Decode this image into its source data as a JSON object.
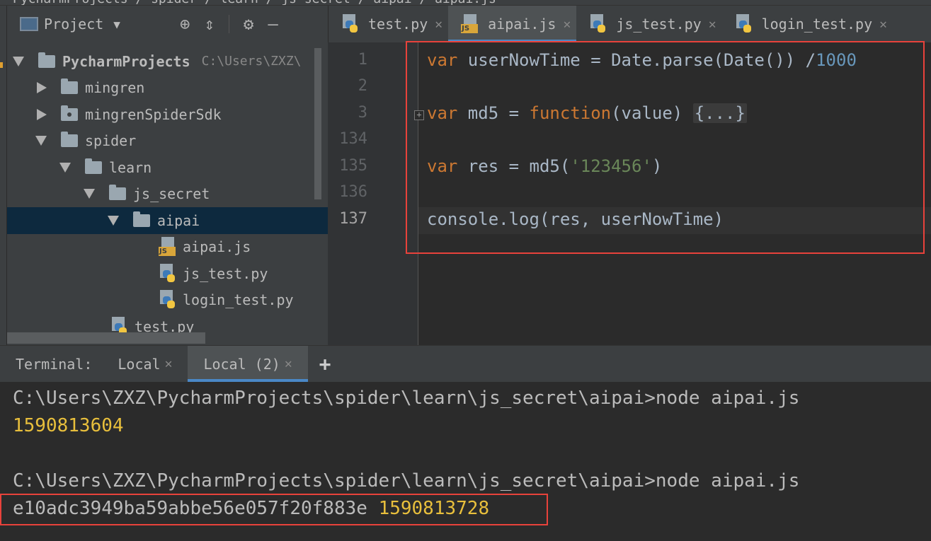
{
  "breadcrumb": {
    "items": [
      "PycharmProjects",
      "spider",
      "learn",
      "js_secret",
      "aipai",
      "aipai.js"
    ]
  },
  "project_panel": {
    "title": "Project",
    "tree": [
      {
        "label": "PycharmProjects",
        "hint": "C:\\Users\\ZXZ\\",
        "kind": "folder",
        "expanded": true
      },
      {
        "label": "mingren",
        "kind": "folder",
        "expanded": false
      },
      {
        "label": "mingrenSpiderSdk",
        "kind": "folder",
        "expanded": false
      },
      {
        "label": "spider",
        "kind": "folder",
        "expanded": true
      },
      {
        "label": "learn",
        "kind": "folder",
        "expanded": true
      },
      {
        "label": "js_secret",
        "kind": "folder",
        "expanded": true
      },
      {
        "label": "aipai",
        "kind": "folder",
        "expanded": true,
        "selected": true
      },
      {
        "label": "aipai.js",
        "kind": "js"
      },
      {
        "label": "js_test.py",
        "kind": "py"
      },
      {
        "label": "login_test.py",
        "kind": "py"
      },
      {
        "label": "test.py",
        "kind": "py"
      }
    ]
  },
  "editor_tabs": [
    {
      "label": "test.py",
      "icon": "python-file-icon"
    },
    {
      "label": "aipai.js",
      "icon": "js-file-icon",
      "active": true
    },
    {
      "label": "js_test.py",
      "icon": "python-file-icon"
    },
    {
      "label": "login_test.py",
      "icon": "python-file-icon"
    }
  ],
  "editor": {
    "line_numbers": [
      "1",
      "2",
      "3",
      "134",
      "135",
      "136",
      "137"
    ],
    "code": {
      "line1": {
        "kw": "var",
        "rest": " userNowTime = Date.parse(Date()) /",
        "num": "1000"
      },
      "line3": {
        "kw": "var",
        "mid": " md5 = ",
        "fn": "function",
        "params": "(value) ",
        "folded": "{...}"
      },
      "line135": {
        "kw": "var",
        "mid": " res = md5(",
        "str": "'123456'",
        "end": ")"
      },
      "line137": {
        "text": "console.log(res, userNowTime)"
      }
    }
  },
  "terminal": {
    "label": "Terminal:",
    "tabs": [
      {
        "label": "Local"
      },
      {
        "label": "Local (2)",
        "active": true
      }
    ],
    "add_label": "+",
    "output": {
      "cmd1": "C:\\Users\\ZXZ\\PycharmProjects\\spider\\learn\\js_secret\\aipai>node aipai.js",
      "out1": "1590813604",
      "cmd2": "C:\\Users\\ZXZ\\PycharmProjects\\spider\\learn\\js_secret\\aipai>node aipai.js",
      "out2_hash": "e10adc3949ba59abbe56e057f20f883e",
      "out2_time": "1590813728"
    }
  },
  "colors": {
    "highlight_box": "#e8423b",
    "accent": "#4a88c7",
    "keyword": "#cc7832",
    "string": "#6a8759",
    "number": "#6897bb",
    "terminal_yellow": "#e8bf3c"
  }
}
